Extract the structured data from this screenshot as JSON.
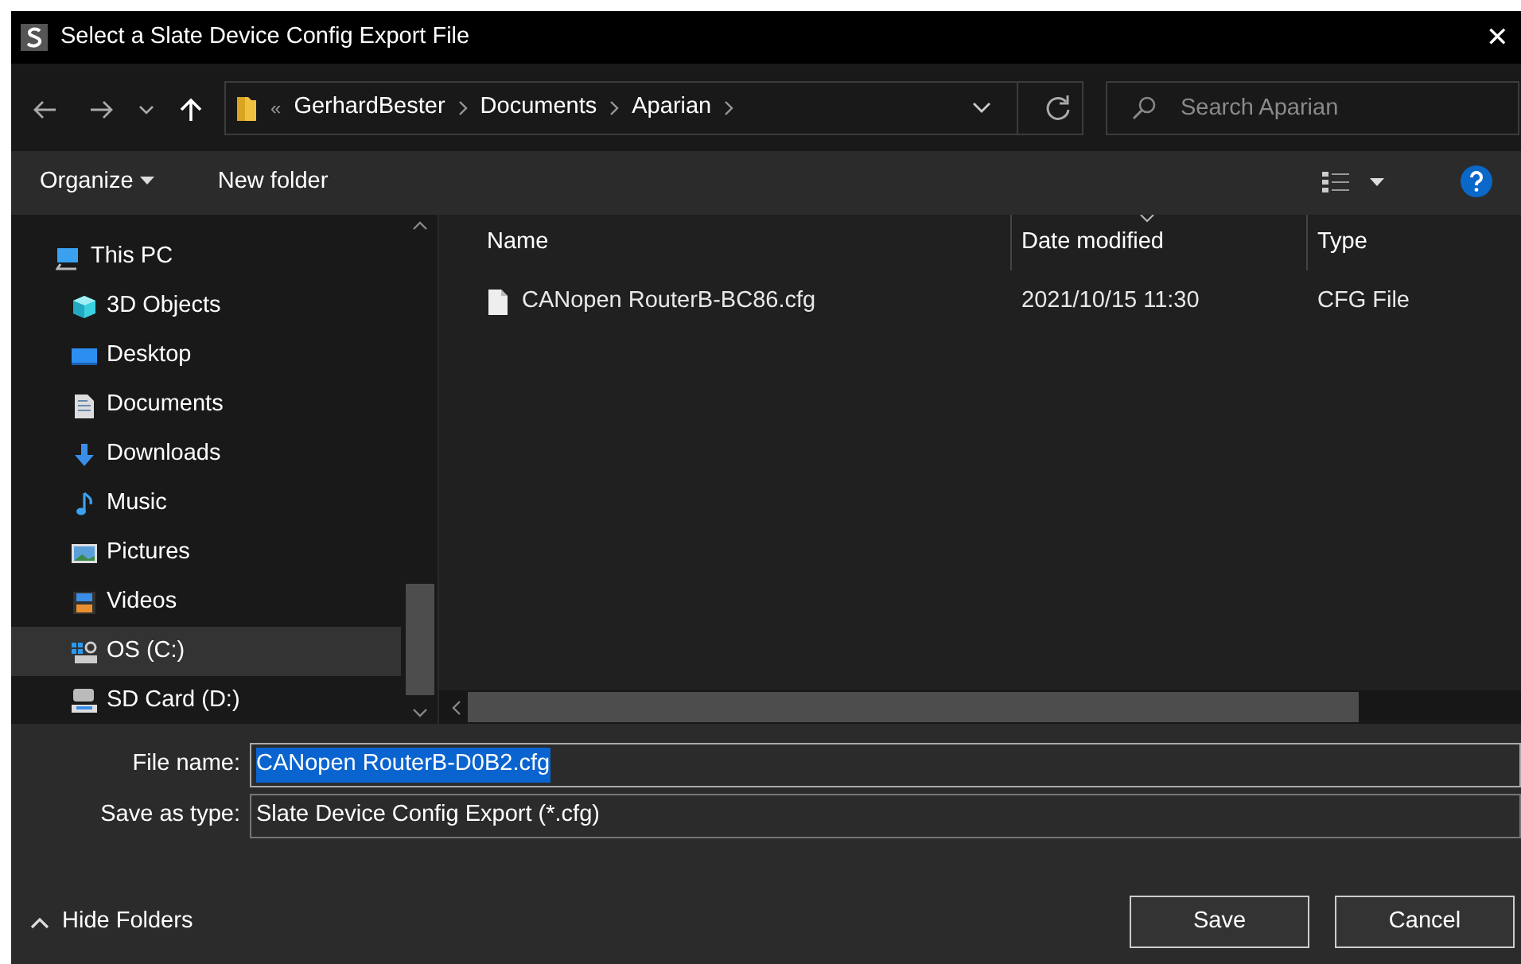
{
  "window": {
    "title": "Select a Slate Device Config Export File",
    "close": "✕"
  },
  "address": {
    "overflow": "«",
    "segments": [
      "GerhardBester",
      "Documents",
      "Aparian"
    ]
  },
  "search": {
    "placeholder": "Search Aparian"
  },
  "toolbar": [
    {
      "label": "Organize",
      "dropdown": true
    },
    {
      "label": "New folder",
      "dropdown": false
    }
  ],
  "sidebar": {
    "items": [
      {
        "label": "This PC",
        "selected": false,
        "children": [
          {
            "label": "3D Objects",
            "selected": false
          },
          {
            "label": "Desktop",
            "selected": false
          },
          {
            "label": "Documents",
            "selected": false
          },
          {
            "label": "Downloads",
            "selected": false
          },
          {
            "label": "Music",
            "selected": false
          },
          {
            "label": "Pictures",
            "selected": false
          },
          {
            "label": "Videos",
            "selected": false
          },
          {
            "label": "OS (C:)",
            "selected": true
          },
          {
            "label": "SD Card (D:)",
            "selected": false
          }
        ]
      }
    ]
  },
  "table": {
    "columns": [
      "Name",
      "Date modified",
      "Type"
    ],
    "rows": [
      [
        "CANopen RouterB-BC86.cfg",
        "2021/10/15 11:30",
        "CFG File"
      ]
    ]
  },
  "form": {
    "file_name_label": "File name:",
    "file_name": "CANopen RouterB-D0B2.cfg",
    "file_name_selected": true,
    "type_label": "Save as type:",
    "type": "Slate Device Config Export (*.cfg)"
  },
  "hide_folders": "Hide Folders",
  "buttons": [
    "Save",
    "Cancel"
  ]
}
